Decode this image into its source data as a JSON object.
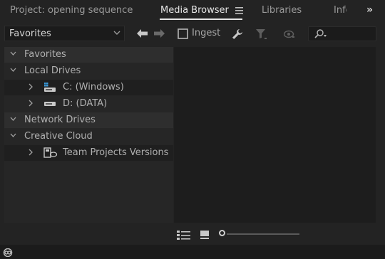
{
  "tabs": [
    {
      "label": "Project: opening sequence"
    },
    {
      "label": "Media Browser"
    },
    {
      "label": "Libraries"
    },
    {
      "label": "Info"
    }
  ],
  "overflow_label": "»",
  "toolbar": {
    "location_dropdown": "Favorites",
    "ingest_label": "Ingest",
    "ingest_checked": false
  },
  "tree": {
    "items": [
      {
        "label": "Favorites",
        "expanded": true,
        "level": 0
      },
      {
        "label": "Local Drives",
        "expanded": true,
        "level": 0
      },
      {
        "label": "C: (Windows)",
        "expanded": false,
        "level": 1,
        "icon": "windows-drive-icon"
      },
      {
        "label": "D: (DATA)",
        "expanded": false,
        "level": 1,
        "icon": "hard-drive-icon"
      },
      {
        "label": "Network Drives",
        "expanded": true,
        "level": 0
      },
      {
        "label": "Creative Cloud",
        "expanded": true,
        "level": 0
      },
      {
        "label": "Team Projects Versions",
        "expanded": false,
        "level": 1,
        "icon": "team-projects-icon"
      }
    ]
  },
  "colors": {
    "background": "#232323",
    "panel": "#262626",
    "active_tab_text": "#e6e6e6",
    "inactive_tab_text": "#9a9a9a"
  }
}
